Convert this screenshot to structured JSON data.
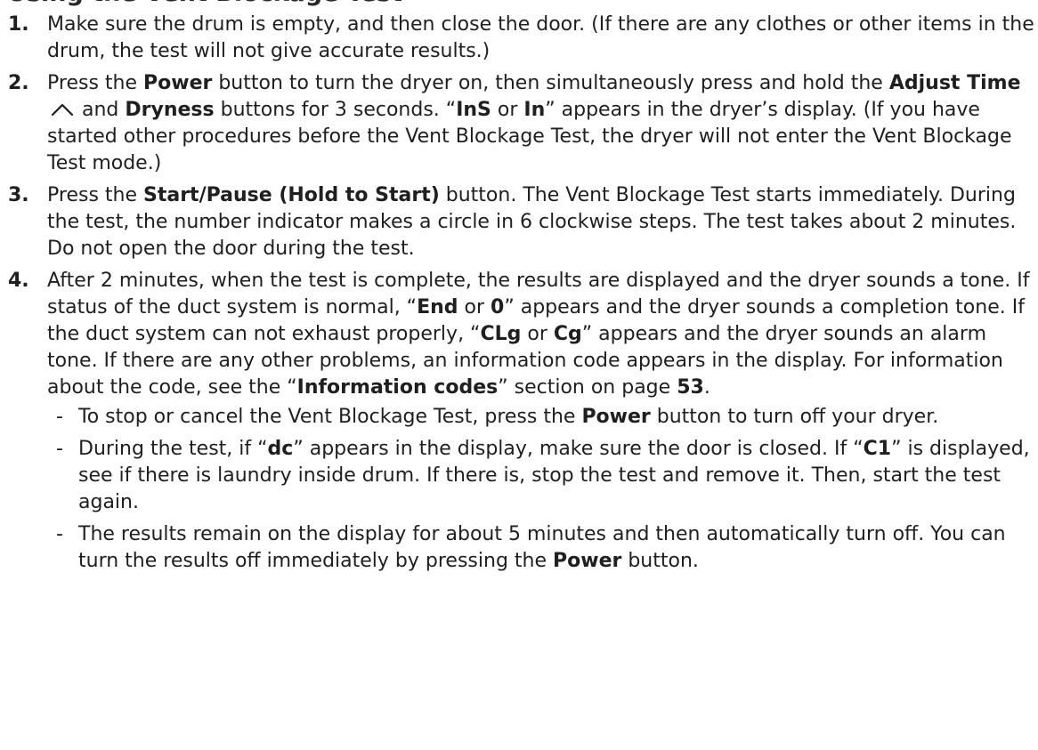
{
  "heading": "Using the Vent Blockage Test",
  "steps": {
    "s1": {
      "num": "1.",
      "t1": "Make sure the drum is empty, and then close the door. (If there are any clothes or other items in the drum, the test will not give accurate results.)"
    },
    "s2": {
      "num": "2.",
      "t1": "Press the ",
      "b1": "Power",
      "t2": " button to turn the dryer on, then simultaneously press and hold the ",
      "b2": "Adjust Time",
      "icon": "chevron-up-icon",
      "t3": " and ",
      "b3": "Dryness",
      "t4": " buttons for 3 seconds. “",
      "b4": "InS",
      "t5": " or ",
      "b5": "In",
      "t6": "” appears in the dryer’s display. (If you have started other procedures before the Vent Blockage Test, the dryer will not enter the Vent Blockage Test mode.)"
    },
    "s3": {
      "num": "3.",
      "t1": "Press the ",
      "b1": "Start/Pause (Hold to Start)",
      "t2": " button. The Vent Blockage Test starts immediately. During the test, the number indicator makes a circle in 6 clockwise steps. The test takes about 2 minutes. Do not open the door during the test."
    },
    "s4": {
      "num": "4.",
      "t1": "After 2 minutes, when the test is complete, the results are displayed and the dryer sounds a tone. If status of the duct system is normal, “",
      "b1": "End",
      "t2": " or ",
      "b2": "0",
      "t3": "” appears and the dryer sounds a completion tone. If the duct system can not exhaust properly, “",
      "b3": "CLg",
      "t4": " or ",
      "b4": "Cg",
      "t5": "” appears and the dryer sounds an alarm tone. If there are any other problems, an information code appears in the display. For information about the code, see the “",
      "b5": "Information codes",
      "t6": "” section on page ",
      "b6": "53",
      "t7": ".",
      "bullets": {
        "dash": "-",
        "a": {
          "t1": "To stop or cancel the Vent Blockage Test, press the ",
          "b1": "Power",
          "t2": " button to turn off your dryer."
        },
        "b": {
          "t1": "During the test, if “",
          "b1": "dc",
          "t2": "” appears in the display, make sure the door is closed. If “",
          "b2": "C1",
          "t3": "” is displayed, see if there is laundry inside drum. If there is, stop the test and remove it. Then, start the test again."
        },
        "c": {
          "t1": "The results remain on the display for about 5 minutes and then automatically turn off. You can turn the results off immediately by pressing the ",
          "b1": "Power",
          "t2": " button."
        }
      }
    }
  }
}
